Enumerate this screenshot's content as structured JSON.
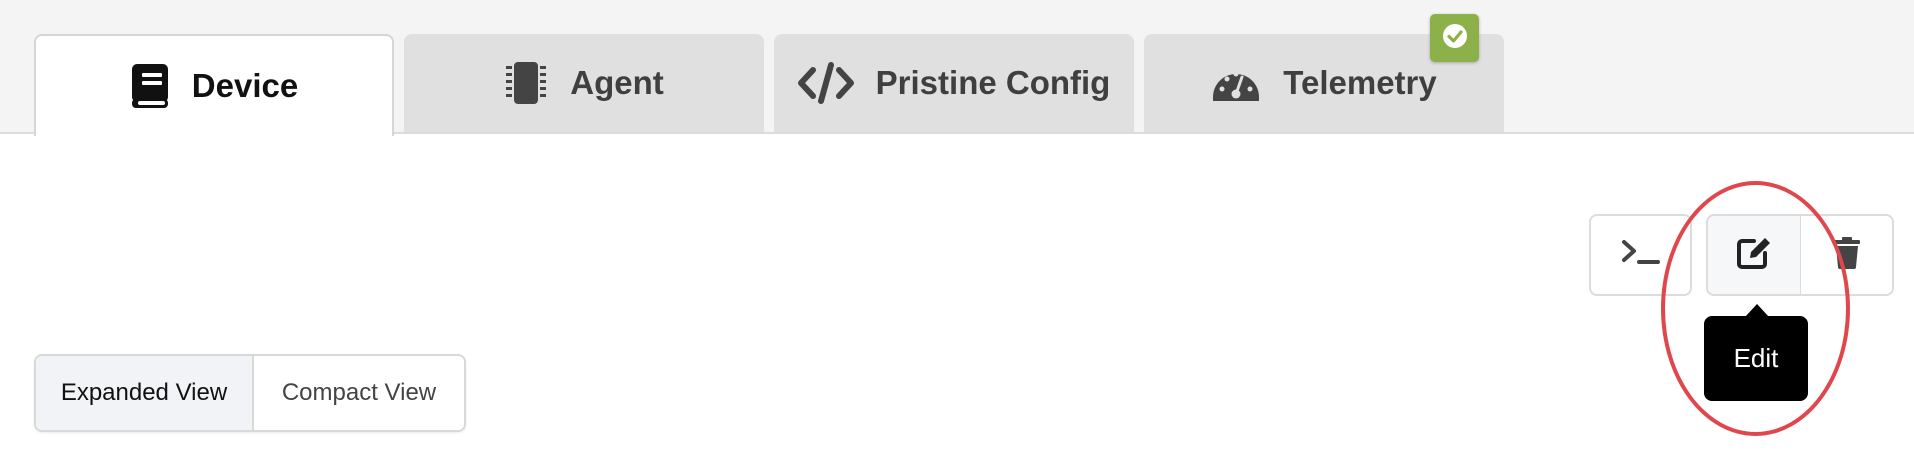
{
  "tabs": [
    {
      "label": "Device",
      "icon": "book-icon",
      "active": true
    },
    {
      "label": "Agent",
      "icon": "chip-icon",
      "active": false
    },
    {
      "label": "Pristine Config",
      "icon": "code-icon",
      "active": false
    },
    {
      "label": "Telemetry",
      "icon": "gauge-icon",
      "active": false
    }
  ],
  "telemetry_badge": {
    "icon": "check-circle-icon",
    "color": "#8cb14a"
  },
  "actions": {
    "terminal_icon": "terminal-icon",
    "edit_icon": "edit-icon",
    "delete_icon": "trash-icon"
  },
  "tooltip": {
    "text": "Edit"
  },
  "highlight": {
    "color": "#e0474c"
  },
  "view_toggle": {
    "expanded_label": "Expanded View",
    "compact_label": "Compact View",
    "selected": "Expanded View"
  }
}
